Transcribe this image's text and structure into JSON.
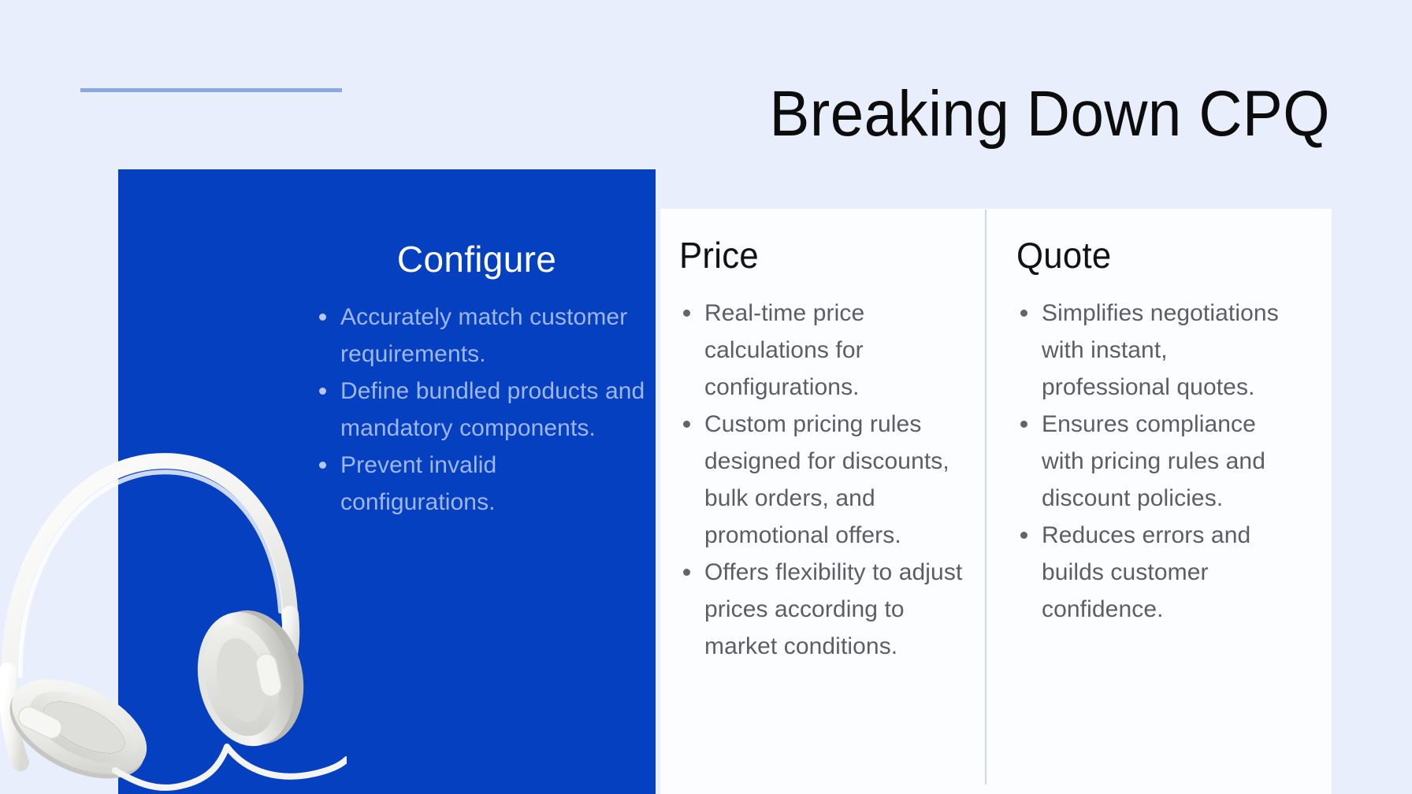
{
  "slide": {
    "title": "Breaking Down CPQ",
    "background_color": "#e8eefc",
    "accent_rule_color": "#8ba8dd",
    "panel_blue": "#0540c0",
    "card_white": "#fcfdff"
  },
  "columns": [
    {
      "id": "configure",
      "heading": "Configure",
      "heading_color": "#ffffff",
      "text_color": "#9fb6e8",
      "bullets": [
        "Accurately match customer requirements.",
        "Define bundled products and mandatory components.",
        "Prevent invalid configurations."
      ]
    },
    {
      "id": "price",
      "heading": "Price",
      "heading_color": "#121212",
      "text_color": "#5d5d63",
      "bullets": [
        "Real-time price calculations for configurations.",
        "Custom pricing rules designed for discounts, bulk orders, and promotional offers.",
        "Offers flexibility to adjust prices according to market conditions."
      ]
    },
    {
      "id": "quote",
      "heading": "Quote",
      "heading_color": "#121212",
      "text_color": "#5d5d63",
      "bullets": [
        "Simplifies negotiations with instant, professional quotes.",
        "Ensures compliance with pricing rules and discount policies.",
        "Reduces errors and builds customer confidence."
      ]
    }
  ],
  "image": {
    "name": "headphones-photo",
    "description": "White over-ear headphones with cable"
  }
}
